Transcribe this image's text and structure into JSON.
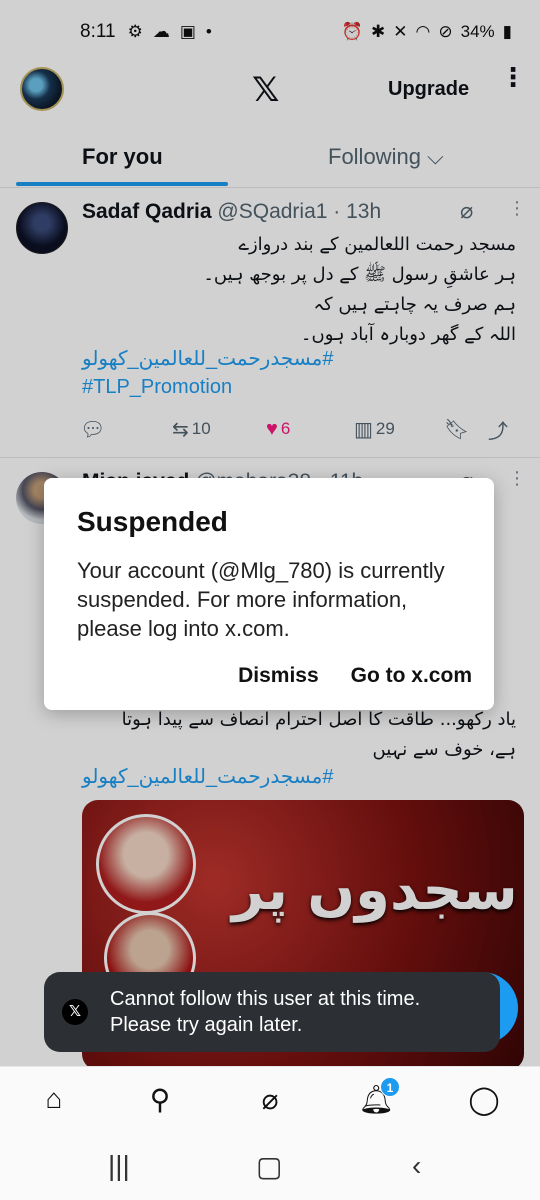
{
  "status_bar": {
    "time": "8:11",
    "battery": "34%"
  },
  "header": {
    "logo": "𝕏",
    "upgrade_label": "Upgrade",
    "menu_glyph": "⋮"
  },
  "tabs": [
    {
      "label": "For you"
    },
    {
      "label": "Following ⌵"
    }
  ],
  "post1": {
    "name": "Sadaf Qadria",
    "handle": "@SQadria1 · 13h",
    "lines": [
      "مسجد رحمت اللعالمین کے بند دروازے",
      "ہر عاشقِ رسول ﷺ کے دل پر بوجھ ہیں۔",
      "ہم صرف یہ چاہتے ہیں کہ",
      "اللہ کے گھر دوبارہ آباد ہوں۔"
    ],
    "hashtags": [
      "مسجدرحمت_للعالمین_کھولو#",
      "#TLP_Promotion"
    ],
    "retweets": "10",
    "likes": "6",
    "views": "29"
  },
  "post2": {
    "name": "Mian javed",
    "handle": "@mahara38 · 11h",
    "lines": [
      "یاد رکھو... طاقت کا اصل احترام انصاف سے پیدا ہوتا",
      "ہے، خوف سے نہیں"
    ],
    "hashtag": "مسجدرحمت_للعالمین_کھولو#",
    "media_title": "سجدوں پر"
  },
  "dialog": {
    "title": "Suspended",
    "message": "Your account (@Mlg_780) is currently suspended. For more information, please log into x.com.",
    "dismiss_label": "Dismiss",
    "goto_label": "Go to x.com"
  },
  "toast": {
    "icon": "𝕏",
    "message": "Cannot follow this user at this time. Please try again later."
  },
  "fab": {
    "glyph": "+"
  },
  "bottom_nav": {
    "notification_count": "1"
  },
  "colors": {
    "accent": "#1d9bf0",
    "like": "#f91880"
  }
}
